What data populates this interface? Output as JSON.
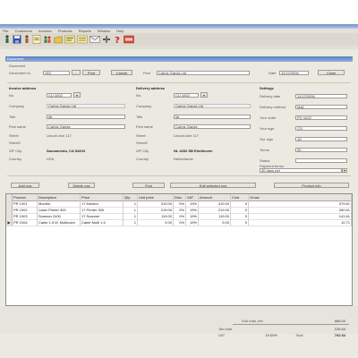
{
  "menu": [
    "File",
    "Customers",
    "Invoices",
    "Products",
    "Reports",
    "Window",
    "Help"
  ],
  "header": {
    "section_title": "Document",
    "number_label": "Document no.",
    "number_value": "153",
    "customer_label": "Find",
    "customer_value": "Carlos Garcia Ltd",
    "date_label": "Date",
    "date_value": "11/12/2006",
    "print_btn": "Print",
    "cancel_btn": "Cancel",
    "ok_btn": "Close",
    "find_btn": "..."
  },
  "invoice_address": {
    "title": "Invoice address",
    "fields": [
      {
        "label": "No.",
        "value": "CU 1002"
      },
      {
        "label": "Company",
        "value": "Carlos Garcia Ltd"
      },
      {
        "label": "Title",
        "value": "Mr"
      },
      {
        "label": "First name",
        "value": "Carlos Garcia"
      },
      {
        "label": "Street",
        "value": "Lincoln Ave 117"
      },
      {
        "label": "Street2",
        "value": ""
      },
      {
        "label": "ZIP City",
        "value": "Sacramento, CA 94203"
      },
      {
        "label": "Country",
        "value": "USA"
      }
    ]
  },
  "delivery_address": {
    "title": "Delivery address",
    "fields": [
      {
        "label": "No.",
        "value": "CU 1002"
      },
      {
        "label": "Company",
        "value": "Carlos Garcia Ltd"
      },
      {
        "label": "Title",
        "value": "Mr"
      },
      {
        "label": "First name",
        "value": "Carlos Garcia"
      },
      {
        "label": "Street",
        "value": "Lincoln Ave 117"
      },
      {
        "label": "Street2",
        "value": ""
      },
      {
        "label": "ZIP City",
        "value": "NL 4202 SB Eindhoven"
      },
      {
        "label": "Country",
        "value": "Netherlands"
      }
    ]
  },
  "settings": {
    "title": "Settings",
    "fields": [
      {
        "label": "Delivery date",
        "value": "11/12/2006"
      },
      {
        "label": "Delivery method",
        "value": "Mail"
      },
      {
        "label": "Your order",
        "value": "PO 1022"
      },
      {
        "label": "Your sign",
        "value": "CG"
      },
      {
        "label": "Our sign",
        "value": "JD"
      },
      {
        "label": "Terms",
        "value": "30"
      },
      {
        "label": "Status",
        "value": ""
      }
    ],
    "payment_label": "Payment terms",
    "payment_value": "30 days net"
  },
  "actions": {
    "add_btn": "Add row",
    "delete_btn": "Delete row",
    "find_btn": "Find",
    "edit_btn": "Edit selected row",
    "extra_btn": "Product info"
  },
  "grid": {
    "columns": [
      "Product",
      "Description",
      "Price",
      "Qty",
      "Unit price",
      "Disc.",
      "VAT",
      "Amount",
      "Cost",
      "Gross"
    ],
    "rows": [
      [
        "PR 1001",
        "Monitor",
        "17 Monitor",
        "1",
        "319.00",
        "0%",
        "19%",
        "319.00",
        "0",
        "379.61"
      ],
      [
        "PR 1002",
        "Laser Printer 300",
        "17 Printer 300",
        "1",
        "219.00",
        "0%",
        "19%",
        "219.00",
        "0",
        "260.61"
      ],
      [
        "PR 1003",
        "Scanner 2400",
        "17 Scanner",
        "1",
        "119.00",
        "0%",
        "19%",
        "119.00",
        "0",
        "141.61"
      ],
      [
        "PR 1004",
        "Cable 1.5 M, Multicolor",
        "Cable Multi 1.5",
        "1",
        "9.00",
        "0%",
        "19%",
        "9.00",
        "0",
        "10.71"
      ]
    ]
  },
  "totals": {
    "net_label": "Sub total, net",
    "net_value": "666.00",
    "tax_label": "Tax total",
    "tax_value": "126.54",
    "vat_label": "VAT",
    "vat_value": "19.00%",
    "gross_label": "Total",
    "gross_value": "792.54"
  },
  "colors": {
    "titlebar": "#6f8fc8",
    "window": "#ece9e1",
    "accent_red": "#d21f1f"
  }
}
